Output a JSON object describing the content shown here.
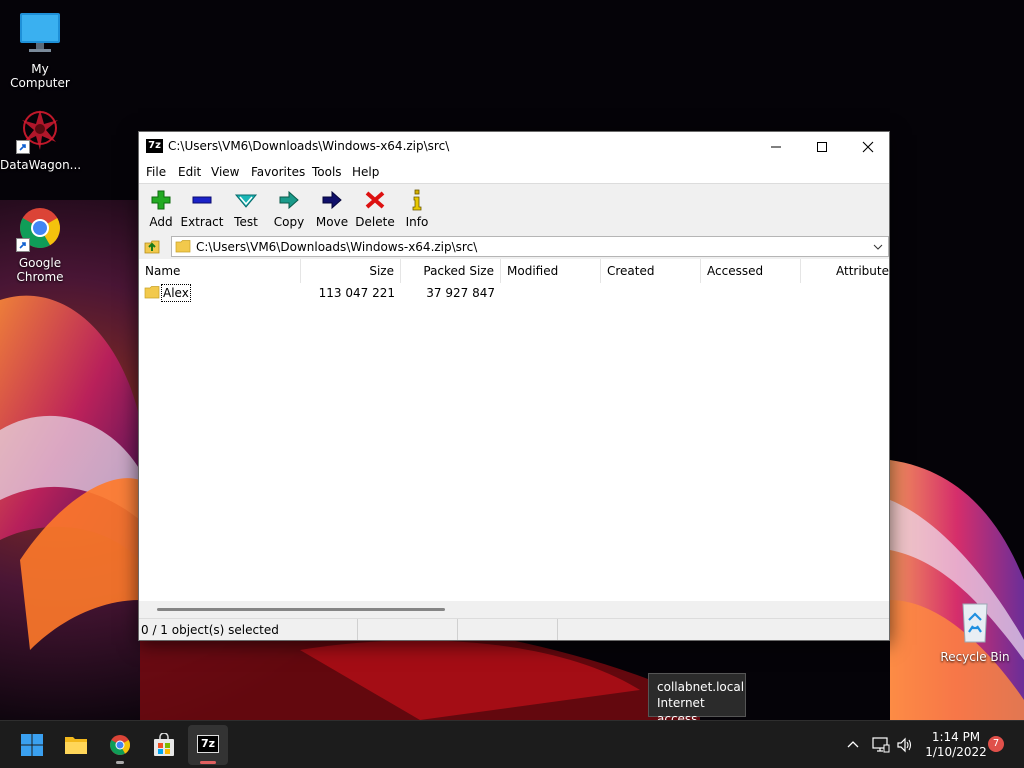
{
  "desktop": {
    "icons": [
      {
        "label": "My Computer"
      },
      {
        "label": "DataWagon..."
      },
      {
        "label": "Google Chrome"
      },
      {
        "label": "Recycle Bin"
      }
    ]
  },
  "window": {
    "title": "C:\\Users\\VM6\\Downloads\\Windows-x64.zip\\src\\",
    "app_icon_text": "7z",
    "menu": [
      "File",
      "Edit",
      "View",
      "Favorites",
      "Tools",
      "Help"
    ],
    "toolbar": [
      {
        "label": "Add",
        "icon": "add-icon",
        "color": "#22aa22"
      },
      {
        "label": "Extract",
        "icon": "extract-icon",
        "color": "#1a22c8"
      },
      {
        "label": "Test",
        "icon": "test-icon",
        "color": "#1aa6a6"
      },
      {
        "label": "Copy",
        "icon": "copy-icon",
        "color": "#1a8a7a"
      },
      {
        "label": "Move",
        "icon": "move-icon",
        "color": "#10106a"
      },
      {
        "label": "Delete",
        "icon": "delete-icon",
        "color": "#dd1111"
      },
      {
        "label": "Info",
        "icon": "info-icon",
        "color": "#c8a800"
      }
    ],
    "address": "C:\\Users\\VM6\\Downloads\\Windows-x64.zip\\src\\",
    "columns": [
      "Name",
      "Size",
      "Packed Size",
      "Modified",
      "Created",
      "Accessed",
      "Attribute"
    ],
    "rows": [
      {
        "name": "Alex",
        "size": "113 047 221",
        "packed_size": "37 927 847",
        "modified": "",
        "created": "",
        "accessed": "",
        "attributes": ""
      }
    ],
    "status": "0 / 1 object(s) selected"
  },
  "tooltip": {
    "line1": "collabnet.local",
    "line2": "Internet access"
  },
  "taskbar": {
    "time": "1:14 PM",
    "date": "1/10/2022",
    "notification_count": "7",
    "apps": [
      "start",
      "file-explorer",
      "chrome",
      "store",
      "7zip"
    ]
  }
}
